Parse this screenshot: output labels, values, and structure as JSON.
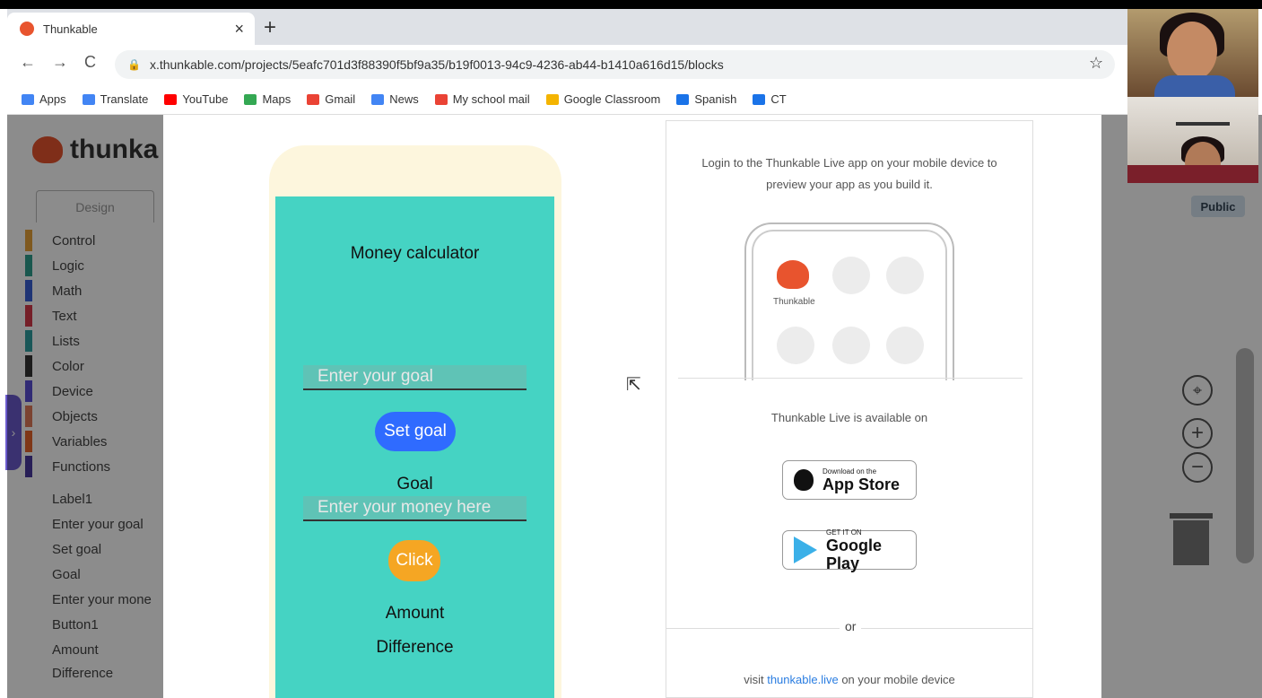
{
  "browser": {
    "tab_title": "Thunkable",
    "tab_close": "×",
    "new_tab": "+",
    "back": "←",
    "forward": "→",
    "reload": "C",
    "url": "x.thunkable.com/projects/5eafc701d3f88390f5bf9a35/b19f0013-94c9-4236-ab44-b1410a616d15/blocks",
    "star": "☆",
    "bookmarks": [
      {
        "label": "Apps",
        "color": "#4285f4"
      },
      {
        "label": "Translate",
        "color": "#4285f4"
      },
      {
        "label": "YouTube",
        "color": "#ff0000"
      },
      {
        "label": "Maps",
        "color": "#34a853"
      },
      {
        "label": "Gmail",
        "color": "#ea4335"
      },
      {
        "label": "News",
        "color": "#4285f4"
      },
      {
        "label": "My school mail",
        "color": "#ea4335"
      },
      {
        "label": "Google Classroom",
        "color": "#f4b400"
      },
      {
        "label": "Spanish",
        "color": "#1a73e8"
      },
      {
        "label": "CT",
        "color": "#1a73e8"
      }
    ]
  },
  "editor": {
    "logo_text": "thunka",
    "design_tab": "Design",
    "categories": [
      {
        "label": "Control",
        "color": "#e8a33a"
      },
      {
        "label": "Logic",
        "color": "#2e9e8f"
      },
      {
        "label": "Math",
        "color": "#3a5fd6"
      },
      {
        "label": "Text",
        "color": "#d63a4a"
      },
      {
        "label": "Lists",
        "color": "#2e9ea0"
      },
      {
        "label": "Color",
        "color": "#333333"
      },
      {
        "label": "Device",
        "color": "#5a4fd6"
      },
      {
        "label": "Objects",
        "color": "#e07a5a"
      },
      {
        "label": "Variables",
        "color": "#e8642a"
      },
      {
        "label": "Functions",
        "color": "#4a3a9e"
      }
    ],
    "components": [
      "Label1",
      "Enter your goal",
      "Set goal",
      "Goal",
      "Enter your mone",
      "Button1",
      "Amount",
      "Difference"
    ],
    "public_badge": "Public"
  },
  "app_preview": {
    "title_label": "Money calculator",
    "goal_input_placeholder": "Enter your goal",
    "set_goal_button": "Set goal",
    "goal_label": "Goal",
    "money_input_placeholder": "Enter your money here",
    "click_button": "Click",
    "amount_label": "Amount",
    "difference_label": "Difference",
    "screen_color": "#45d3c3",
    "set_goal_color": "#2f6bff",
    "click_color": "#f5a623"
  },
  "live_panel": {
    "intro": "Login to the Thunkable Live app on your mobile device to preview your app as you build it.",
    "mini_app_label": "Thunkable",
    "available_text": "Thunkable Live is available on",
    "app_store_small": "Download on the",
    "app_store_big": "App Store",
    "google_play_small": "GET IT ON",
    "google_play_big": "Google Play",
    "or_text": "or",
    "visit_prefix": "visit ",
    "visit_link": "thunkable.live",
    "visit_suffix": " on your mobile device"
  }
}
